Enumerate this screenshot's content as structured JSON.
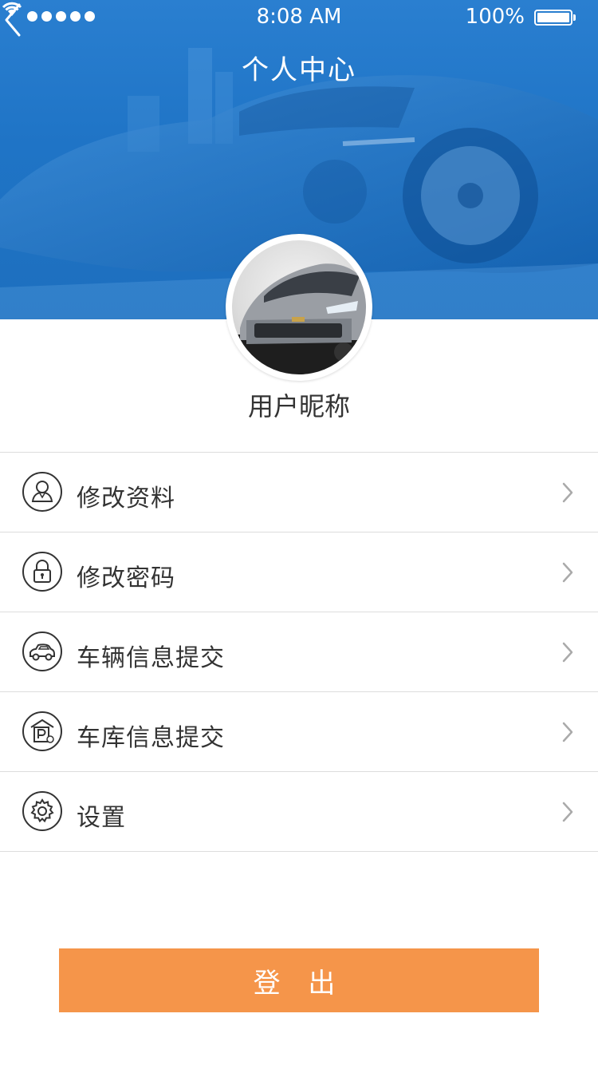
{
  "status_bar": {
    "time": "8:08 AM",
    "battery": "100%"
  },
  "header": {
    "title": "个人中心"
  },
  "profile": {
    "nickname": "用户昵称"
  },
  "menu": {
    "items": [
      {
        "label": "修改资料",
        "icon": "user-icon"
      },
      {
        "label": "修改密码",
        "icon": "lock-icon"
      },
      {
        "label": "车辆信息提交",
        "icon": "car-icon"
      },
      {
        "label": "车库信息提交",
        "icon": "garage-icon"
      },
      {
        "label": "设置",
        "icon": "gear-icon"
      }
    ]
  },
  "logout": {
    "label": "登 出"
  },
  "colors": {
    "header_blue": "#1f74c6",
    "logout_orange": "#f5954a",
    "divider": "#dddddd"
  }
}
